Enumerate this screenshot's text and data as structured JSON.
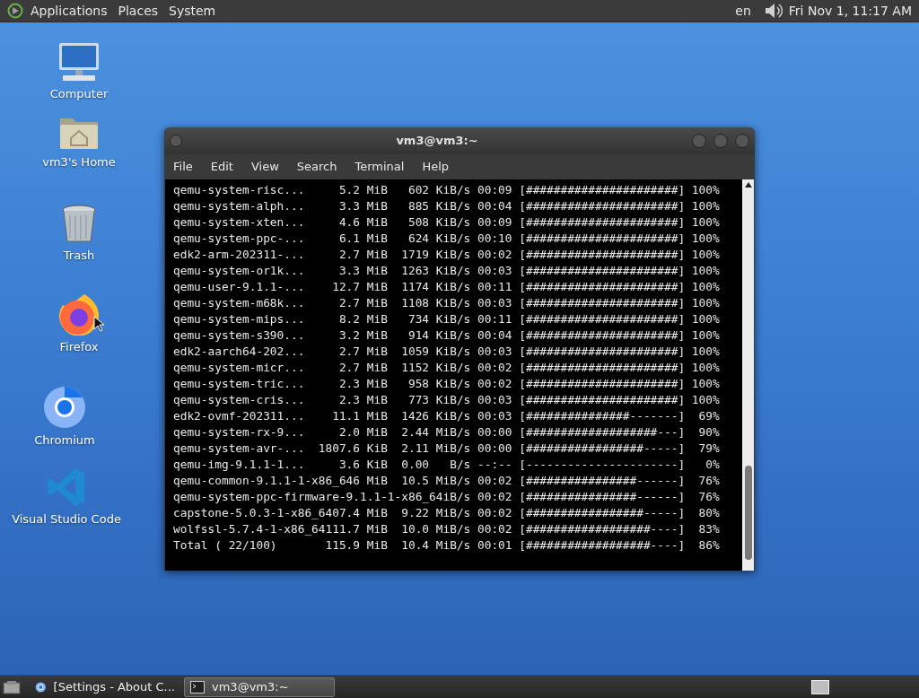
{
  "top_panel": {
    "menus": [
      "Applications",
      "Places",
      "System"
    ],
    "keyboard_layout": "en",
    "clock": "Fri Nov 1, 11:17 AM"
  },
  "desktop_icons": [
    {
      "kind": "computer",
      "label": "Computer"
    },
    {
      "kind": "home",
      "label": "vm3's Home"
    },
    {
      "kind": "trash",
      "label": "Trash"
    },
    {
      "kind": "firefox",
      "label": "Firefox"
    },
    {
      "kind": "chromium",
      "label": "Chromium"
    },
    {
      "kind": "vscode",
      "label": "Visual Studio Code"
    }
  ],
  "terminal": {
    "title": "vm3@vm3:~",
    "menu": [
      "File",
      "Edit",
      "View",
      "Search",
      "Terminal",
      "Help"
    ],
    "lines": [
      "qemu-system-risc...     5.2 MiB   602 KiB/s 00:09 [######################] 100%",
      "qemu-system-alph...     3.3 MiB   885 KiB/s 00:04 [######################] 100%",
      "qemu-system-xten...     4.6 MiB   508 KiB/s 00:09 [######################] 100%",
      "qemu-system-ppc-...     6.1 MiB   624 KiB/s 00:10 [######################] 100%",
      "edk2-arm-202311-...     2.7 MiB  1719 KiB/s 00:02 [######################] 100%",
      "qemu-system-or1k...     3.3 MiB  1263 KiB/s 00:03 [######################] 100%",
      "qemu-user-9.1.1-...    12.7 MiB  1174 KiB/s 00:11 [######################] 100%",
      "qemu-system-m68k...     2.7 MiB  1108 KiB/s 00:03 [######################] 100%",
      "qemu-system-mips...     8.2 MiB   734 KiB/s 00:11 [######################] 100%",
      "qemu-system-s390...     3.2 MiB   914 KiB/s 00:04 [######################] 100%",
      "edk2-aarch64-202...     2.7 MiB  1059 KiB/s 00:03 [######################] 100%",
      "qemu-system-micr...     2.7 MiB  1152 KiB/s 00:02 [######################] 100%",
      "qemu-system-tric...     2.3 MiB   958 KiB/s 00:02 [######################] 100%",
      "qemu-system-cris...     2.3 MiB   773 KiB/s 00:03 [######################] 100%",
      "edk2-ovmf-202311...    11.1 MiB  1426 KiB/s 00:03 [###############-------]  69%",
      "qemu-system-rx-9...     2.0 MiB  2.44 MiB/s 00:00 [###################---]  90%",
      "qemu-system-avr-...  1807.6 KiB  2.11 MiB/s 00:00 [#################-----]  79%",
      "qemu-img-9.1.1-1...     3.6 KiB  0.00   B/s --:-- [----------------------]   0%",
      "qemu-common-9.1.1-1-x86_646 MiB  10.5 MiB/s 00:02 [################------]  76%",
      "qemu-system-ppc-firmware-9.1.1-1-x86_64iB/s 00:02 [################------]  76%",
      "capstone-5.0.3-1-x86_6407.4 MiB  9.22 MiB/s 00:02 [#################-----]  80%",
      "wolfssl-5.7.4-1-x86_64111.7 MiB  10.0 MiB/s 00:02 [##################----]  83%",
      "Total ( 22/100)       115.9 MiB  10.4 MiB/s 00:01 [##################----]  86%"
    ]
  },
  "taskbar": {
    "tasks": [
      {
        "kind": "browser",
        "label": "[Settings - About C...",
        "selected": false
      },
      {
        "kind": "terminal",
        "label": "vm3@vm3:~",
        "selected": true
      }
    ]
  }
}
